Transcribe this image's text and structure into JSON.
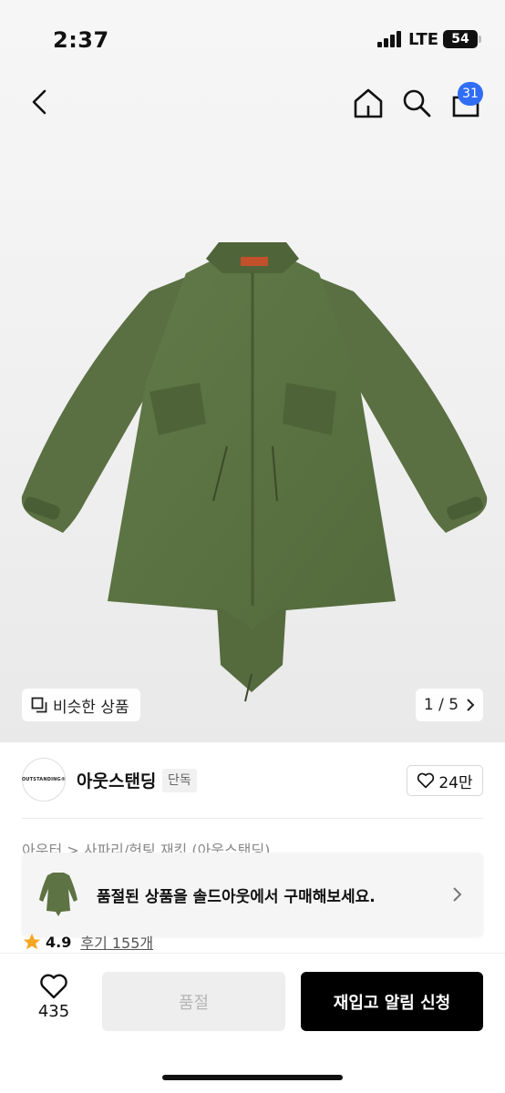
{
  "status_bar": {
    "time": "2:37",
    "network": "LTE",
    "battery": "54"
  },
  "header": {
    "cart_count": "31"
  },
  "gallery": {
    "similar_label": "비슷한 상품",
    "page_indicator": "1 / 5"
  },
  "seller": {
    "logo_text": "OUTSTANDING®",
    "name": "아웃스탠딩",
    "badge": "단독",
    "likes": "24만"
  },
  "breadcrumb": "아우터 > 사파리/헌팅 재킷 (아웃스탠딩)",
  "banner": {
    "text": "품절된 상품을 솔드아웃에서 구매해보세요."
  },
  "rating": {
    "score": "4.9",
    "reviews": "후기 155개"
  },
  "bottom_bar": {
    "wish_count": "435",
    "soldout_label": "품절",
    "restock_label": "재입고 알림 신청"
  },
  "colors": {
    "accent_badge": "#2f6df5",
    "jacket": "#5d7343",
    "star": "#f5a623"
  }
}
